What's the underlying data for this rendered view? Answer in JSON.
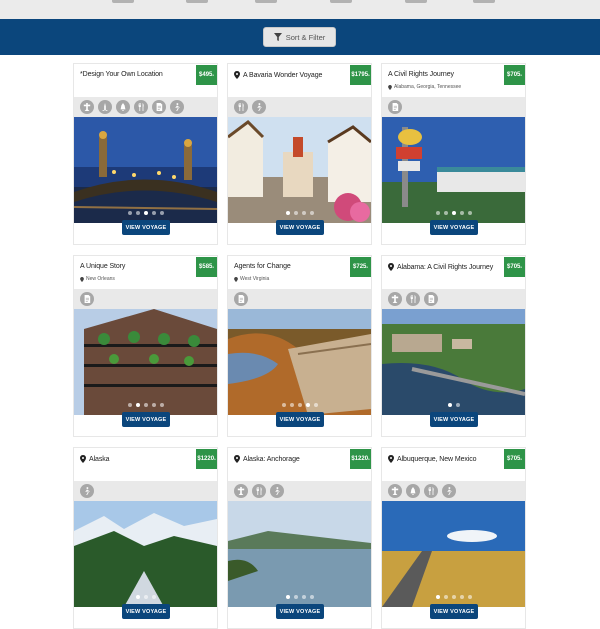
{
  "filter_bar": {
    "sort_filter_label": "Sort & Filter"
  },
  "cards": [
    {
      "title": "*Design Your Own Location",
      "subtitle": "",
      "price": "$495",
      "icons": [
        "monument-icon",
        "landmark-icon",
        "bell-icon",
        "dining-icon",
        "document-icon",
        "walking-icon"
      ],
      "show_pin": false,
      "scene": "bridge",
      "dots": 5,
      "active_dot": 2,
      "view_label": "VIEW VOYAGE"
    },
    {
      "title": "A Bavaria Wonder Voyage",
      "subtitle": "",
      "price": "$1795",
      "icons": [
        "dining-icon",
        "walking-icon"
      ],
      "show_pin": true,
      "scene": "village",
      "dots": 4,
      "active_dot": 0,
      "view_label": "VIEW VOYAGE"
    },
    {
      "title": "A Civil Rights Journey",
      "subtitle": "Alabama, Georgia, Tennessee",
      "price": "$705",
      "icons": [
        "document-icon"
      ],
      "show_pin": false,
      "scene": "motel",
      "dots": 5,
      "active_dot": 2,
      "view_label": "VIEW VOYAGE"
    },
    {
      "title": "A Unique Story",
      "subtitle": "New Orleans",
      "price": "$585",
      "icons": [
        "document-icon"
      ],
      "show_pin": false,
      "scene": "balcony",
      "dots": 5,
      "active_dot": 1,
      "view_label": "VIEW VOYAGE"
    },
    {
      "title": "Agents for Change",
      "subtitle": "West Virginia",
      "price": "$725",
      "icons": [
        "document-icon"
      ],
      "show_pin": false,
      "scene": "cliff",
      "dots": 5,
      "active_dot": 3,
      "view_label": "VIEW VOYAGE"
    },
    {
      "title": "Alabama: A Civil Rights Journey",
      "subtitle": "",
      "price": "$705",
      "icons": [
        "monument-icon",
        "dining-icon",
        "document-icon"
      ],
      "show_pin": true,
      "scene": "river",
      "dots": 2,
      "active_dot": 0,
      "view_label": "VIEW VOYAGE"
    },
    {
      "title": "Alaska",
      "subtitle": "",
      "price": "$1220",
      "icons": [
        "walking-icon"
      ],
      "show_pin": true,
      "scene": "mountains",
      "dots": 3,
      "active_dot": 0,
      "view_label": "VIEW VOYAGE"
    },
    {
      "title": "Alaska: Anchorage",
      "subtitle": "",
      "price": "$1220",
      "icons": [
        "monument-icon",
        "dining-icon",
        "walking-icon"
      ],
      "show_pin": true,
      "scene": "lake",
      "dots": 4,
      "active_dot": 0,
      "view_label": "VIEW VOYAGE"
    },
    {
      "title": "Albuquerque, New Mexico",
      "subtitle": "",
      "price": "$705",
      "icons": [
        "monument-icon",
        "bell-icon",
        "dining-icon",
        "walking-icon"
      ],
      "show_pin": true,
      "scene": "desert",
      "dots": 5,
      "active_dot": 0,
      "view_label": "VIEW VOYAGE"
    }
  ],
  "colors": {
    "nav": "#0b467c",
    "price": "#2e9448",
    "button": "#0b467c",
    "icon_bg": "#a7a7a7"
  }
}
